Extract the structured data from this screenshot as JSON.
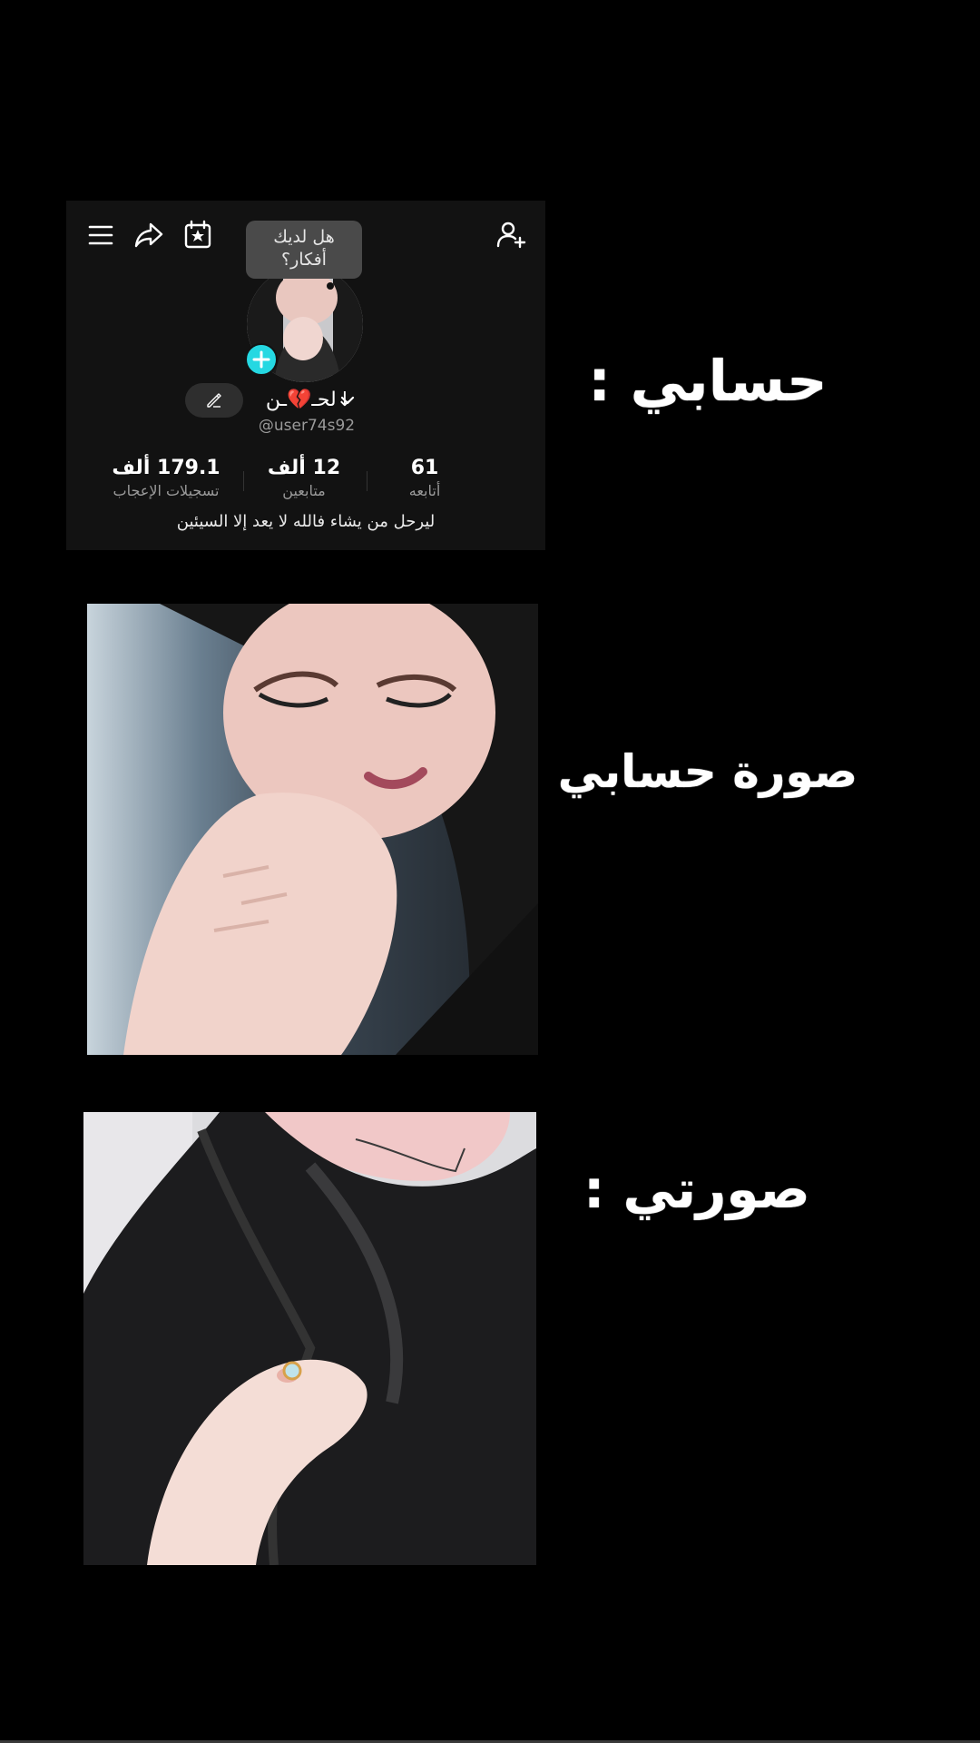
{
  "profile": {
    "thought_prompt_line1": "هل لديك",
    "thought_prompt_line2": "أفكار؟",
    "display_name": "لحـ💔ـن↓",
    "username": "@user74s92",
    "stats": {
      "following_value": "61",
      "following_label": "أتابعه",
      "followers_value": "12 ألف",
      "followers_label": "متابعين",
      "likes_value": "179.1 ألف",
      "likes_label": "تسجيلات الإعجاب"
    },
    "bio": "ليرحل من يشاء فالله لا يعد إلا السيئين"
  },
  "headings": {
    "my_account": "حسابي :",
    "my_account_photo": "صورة حسابي",
    "my_photo": "صورتي :"
  },
  "icons": {
    "menu": "hamburger-menu-icon",
    "share": "share-arrow-icon",
    "calendar": "calendar-star-icon",
    "add_friend": "add-user-icon",
    "edit": "pencil-icon",
    "add_badge": "plus-icon"
  },
  "colors": {
    "background": "#000000",
    "card": "#121212",
    "accent": "#25d8e2"
  }
}
